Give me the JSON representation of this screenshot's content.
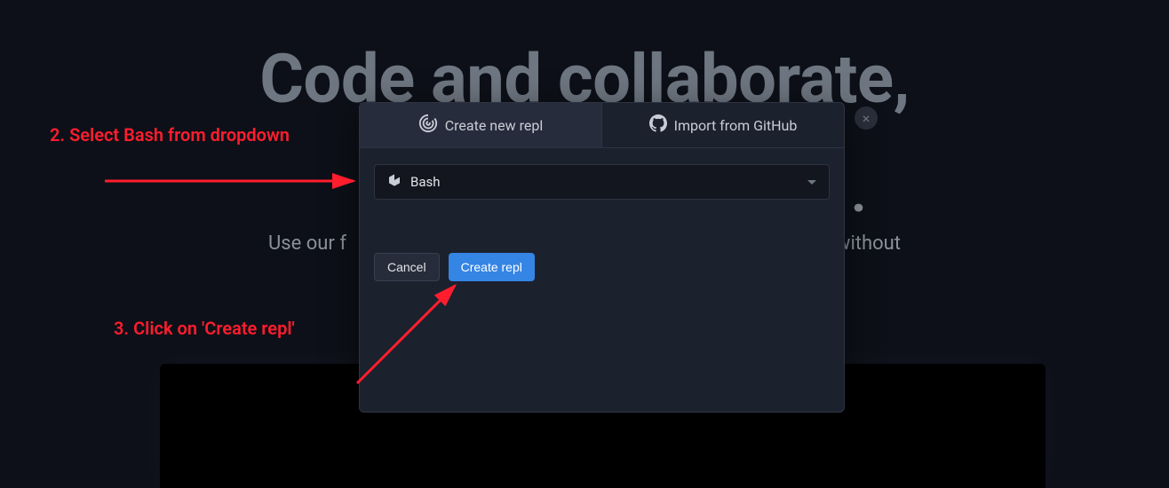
{
  "hero": {
    "title": "Code and collaborate,",
    "subtitle_left": "Use our f",
    "subtitle_right": " without",
    "dot": "."
  },
  "modal": {
    "tabs": {
      "create": "Create new repl",
      "import": "Import from GitHub"
    },
    "dropdown": {
      "selected": "Bash"
    },
    "buttons": {
      "cancel": "Cancel",
      "create": "Create repl"
    }
  },
  "close_label": "×",
  "annotations": {
    "step2": "2. Select Bash from dropdown",
    "step3": "3. Click on 'Create repl'"
  },
  "colors": {
    "annotation": "#ff1d2e",
    "primary_button": "#3485e4",
    "modal_bg": "#1c212e",
    "page_bg": "#0d1018"
  }
}
